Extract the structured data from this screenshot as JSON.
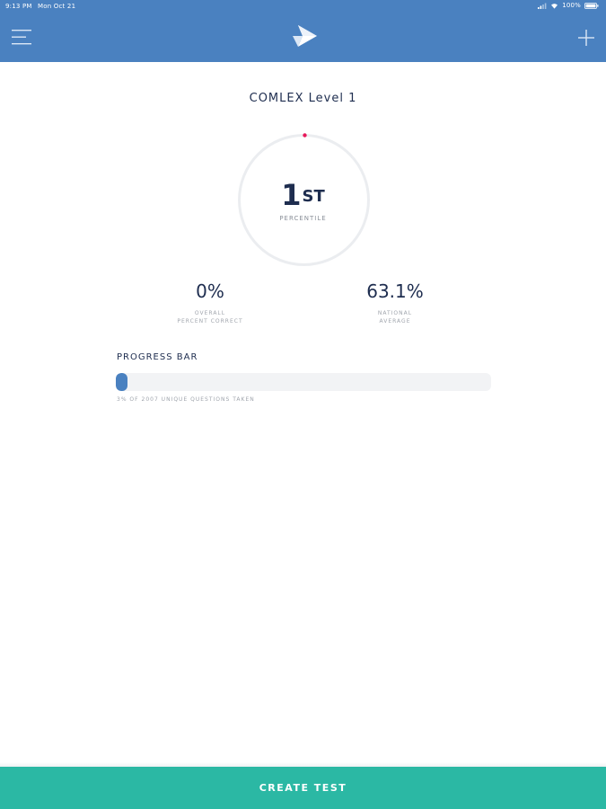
{
  "status_bar": {
    "time": "9:13 PM",
    "date": "Mon Oct 21",
    "battery": "100%"
  },
  "header": {
    "menu_icon": "hamburger-menu-icon",
    "logo_icon": "app-logo-icon",
    "add_icon": "plus-icon",
    "color": "#4a81c0"
  },
  "exam": {
    "title": "COMLEX Level 1"
  },
  "percentile": {
    "number": "1",
    "suffix": "ST",
    "label": "PERCENTILE",
    "value": 1,
    "marker_color": "#e8195a"
  },
  "stats": {
    "overall": {
      "value": "0%",
      "label_line1": "OVERALL",
      "label_line2": "PERCENT CORRECT"
    },
    "national": {
      "value": "63.1%",
      "label_line1": "NATIONAL",
      "label_line2": "AVERAGE"
    }
  },
  "progress": {
    "title": "PROGRESS BAR",
    "caption": "3% OF 2007 UNIQUE QUESTIONS TAKEN",
    "percent": 3,
    "fill_color": "#4a81c0"
  },
  "actions": {
    "create_test_label": "CREATE TEST",
    "color": "#2bb8a4"
  }
}
